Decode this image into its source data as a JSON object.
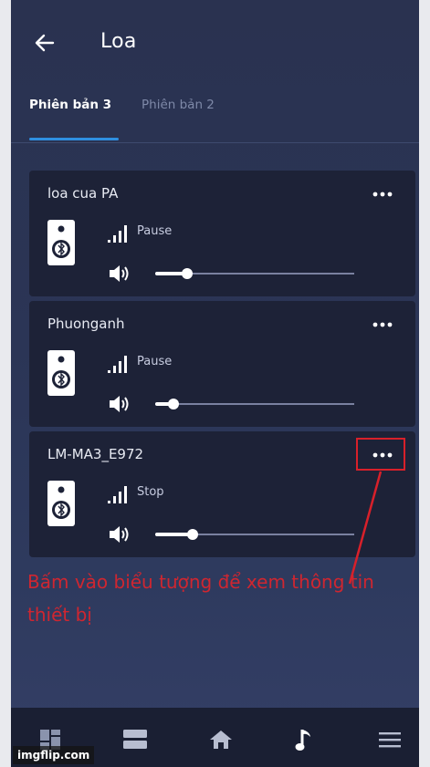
{
  "header": {
    "title": "Loa"
  },
  "tabs": [
    {
      "label": "Phiên bản 3",
      "active": true
    },
    {
      "label": "Phiên bản 2",
      "active": false
    }
  ],
  "devices": [
    {
      "name": "loa cua PA",
      "status": "Pause",
      "volume_fraction": 0.16
    },
    {
      "name": "Phuonganh",
      "status": "Pause",
      "volume_fraction": 0.09
    },
    {
      "name": "LM-MA3_E972",
      "status": "Stop",
      "volume_fraction": 0.19
    }
  ],
  "annotation": {
    "text": "Bấm vào biểu tượng để xem thông tin thiết bị",
    "color": "#cf2630"
  },
  "bottom_nav": [
    {
      "icon": "dashboard-icon"
    },
    {
      "icon": "list-icon"
    },
    {
      "icon": "home-icon"
    },
    {
      "icon": "music-note-icon",
      "active": true
    },
    {
      "icon": "menu-icon"
    }
  ],
  "watermark": "imgflip.com",
  "colors": {
    "accent": "#2f8fe0",
    "card_bg": "#1d2237",
    "highlight": "#d8202a"
  }
}
